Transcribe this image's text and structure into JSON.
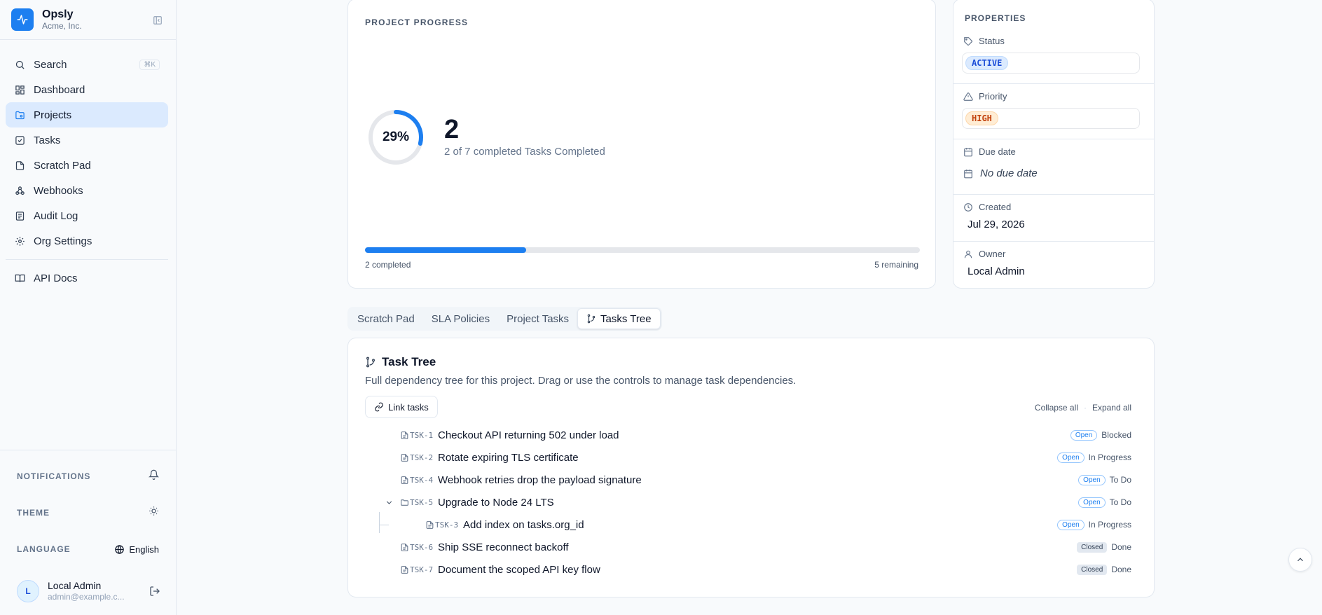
{
  "brand": {
    "name": "Opsly",
    "org": "Acme, Inc."
  },
  "sidebar": {
    "search": {
      "label": "Search",
      "shortcut": "⌘K"
    },
    "items": [
      {
        "label": "Dashboard",
        "icon": "dashboard-icon"
      },
      {
        "label": "Projects",
        "icon": "folder-icon",
        "active": true
      },
      {
        "label": "Tasks",
        "icon": "checkbox-icon"
      },
      {
        "label": "Scratch Pad",
        "icon": "file-icon"
      },
      {
        "label": "Webhooks",
        "icon": "webhook-icon"
      },
      {
        "label": "Audit Log",
        "icon": "audit-icon"
      },
      {
        "label": "Org Settings",
        "icon": "gear-icon"
      }
    ],
    "api_docs": {
      "label": "API Docs",
      "icon": "book-icon"
    },
    "notifications_label": "NOTIFICATIONS",
    "theme_label": "THEME",
    "language_label": "LANGUAGE",
    "language_value": "English",
    "user": {
      "initial": "L",
      "name": "Local Admin",
      "email": "admin@example.c..."
    }
  },
  "progress": {
    "caption": "PROJECT PROGRESS",
    "percent_label": "29%",
    "percent": 0.29,
    "completed_count": "2",
    "summary": "2 of 7 completed Tasks Completed",
    "completed_label": "2 completed",
    "remaining_label": "5 remaining",
    "accent": "#1d7ff0"
  },
  "properties": {
    "title": "PROPERTIES",
    "status_label": "Status",
    "status_value": "ACTIVE",
    "priority_label": "Priority",
    "priority_value": "HIGH",
    "due_label": "Due date",
    "due_value": "No due date",
    "created_label": "Created",
    "created_value": "Jul 29, 2026",
    "owner_label": "Owner",
    "owner_value": "Local Admin"
  },
  "tabs": [
    {
      "label": "Scratch Pad"
    },
    {
      "label": "SLA Policies"
    },
    {
      "label": "Project Tasks"
    },
    {
      "label": "Tasks Tree",
      "active": true
    }
  ],
  "tree": {
    "title": "Task Tree",
    "description": "Full dependency tree for this project. Drag or use the controls to manage task dependencies.",
    "link_button": "Link tasks",
    "collapse_all": "Collapse all",
    "expand_all": "Expand all",
    "separator": "·",
    "rows": [
      {
        "key": "TSK-1",
        "title": "Checkout API returning 502 under load",
        "state": "Open",
        "status": "Blocked",
        "level": 0,
        "folder": false
      },
      {
        "key": "TSK-2",
        "title": "Rotate expiring TLS certificate",
        "state": "Open",
        "status": "In Progress",
        "level": 0,
        "folder": false
      },
      {
        "key": "TSK-4",
        "title": "Webhook retries drop the payload signature",
        "state": "Open",
        "status": "To Do",
        "level": 0,
        "folder": false
      },
      {
        "key": "TSK-5",
        "title": "Upgrade to Node 24 LTS",
        "state": "Open",
        "status": "To Do",
        "level": 0,
        "folder": true
      },
      {
        "key": "TSK-3",
        "title": "Add index on tasks.org_id",
        "state": "Open",
        "status": "In Progress",
        "level": 1,
        "folder": false
      },
      {
        "key": "TSK-6",
        "title": "Ship SSE reconnect backoff",
        "state": "Closed",
        "status": "Done",
        "level": 0,
        "folder": false
      },
      {
        "key": "TSK-7",
        "title": "Document the scoped API key flow",
        "state": "Closed",
        "status": "Done",
        "level": 0,
        "folder": false
      }
    ]
  }
}
